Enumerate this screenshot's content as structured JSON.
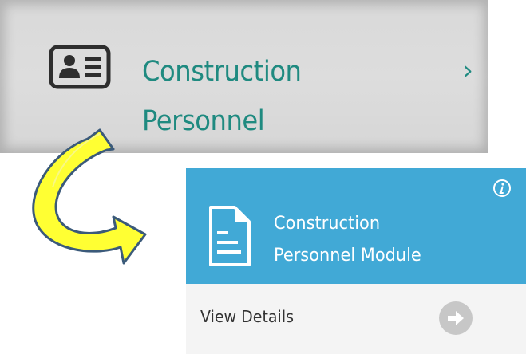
{
  "menu_item": {
    "title_line1": "Construction",
    "title_line2": "Personnel",
    "icon": "id-card-icon",
    "chevron_icon": "chevron-right-icon",
    "accent_color": "#1f8a80"
  },
  "transition_arrow": {
    "icon": "curved-arrow-icon",
    "color": "#ffff33",
    "outline_color": "#3b5a7a"
  },
  "module_card": {
    "title_line1": "Construction",
    "title_line2": "Personnel Module",
    "icon": "document-icon",
    "info_icon": "info-icon",
    "header_color": "#41a9d6",
    "footer": {
      "label": "View Details",
      "button_icon": "arrow-right-icon"
    }
  }
}
